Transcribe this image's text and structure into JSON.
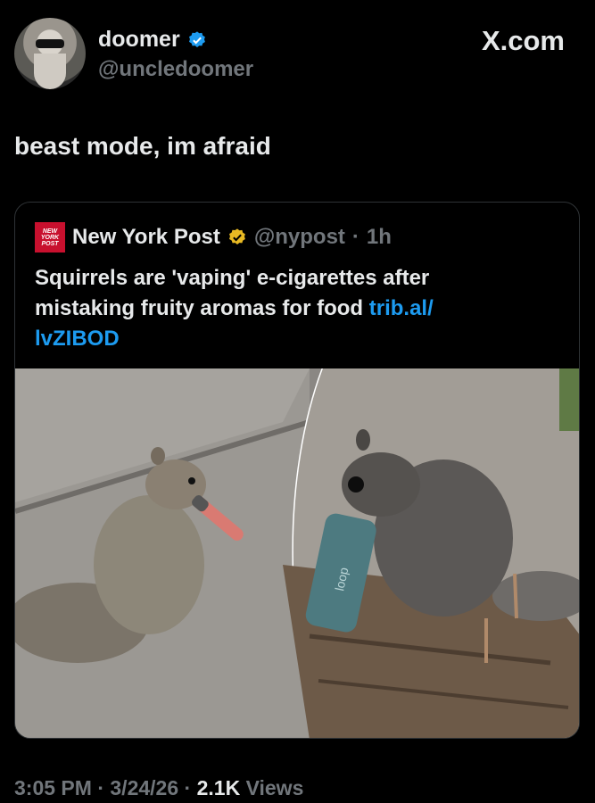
{
  "author": {
    "name": "doomer",
    "handle": "@uncledoomer",
    "verified_color": "#1d9bf0"
  },
  "site_label": "X.com",
  "tweet": {
    "text": "beast mode, im afraid"
  },
  "quoted": {
    "logo_text": "NEW YORK POST",
    "name": "New York Post",
    "handle": "@nypost",
    "time": "1h",
    "text": "Squirrels are 'vaping' e-cigarettes after mistaking fruity aromas for food",
    "link_line1": "trib.al/",
    "link_line2": "lvZIBOD",
    "badge_color": "#e8b923",
    "image": {
      "description_icon": "squirrels-photo",
      "vape_brand": "loop"
    }
  },
  "meta": {
    "time": "3:05 PM",
    "date": "3/24/26",
    "views_count": "2.1K",
    "views_label": "Views"
  },
  "colors": {
    "background": "#000000",
    "text": "#e7e9ea",
    "muted": "#71767b",
    "link": "#1d9bf0",
    "border": "#2f3336"
  }
}
